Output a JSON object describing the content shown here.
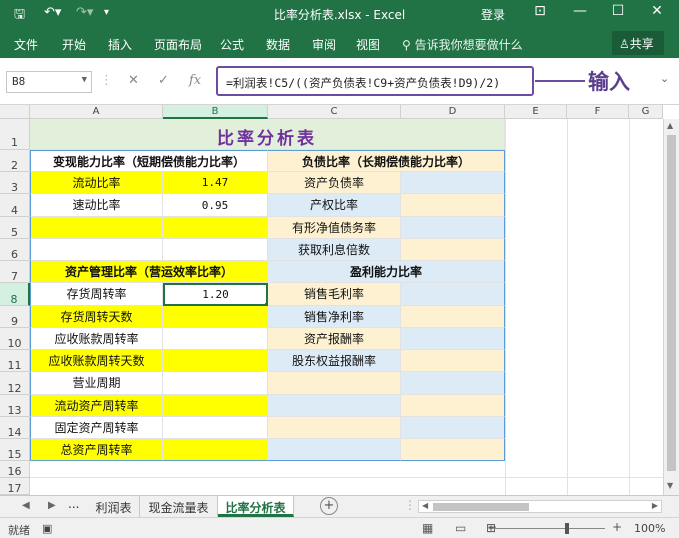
{
  "window": {
    "title": "比率分析表.xlsx - Excel",
    "login": "登录",
    "controls": [
      "⊡",
      "—",
      "☐",
      "✕"
    ]
  },
  "ribbon": {
    "tabs": [
      "文件",
      "开始",
      "插入",
      "页面布局",
      "公式",
      "数据",
      "审阅",
      "视图"
    ],
    "tell_me": "告诉我你想要做什么",
    "share": "共享"
  },
  "formula_bar": {
    "name_box": "B8",
    "formula": "=利润表!C5/((资产负债表!C9+资产负债表!D9)/2)",
    "annotation": "输入"
  },
  "columns": [
    "A",
    "B",
    "C",
    "D",
    "E",
    "F",
    "G"
  ],
  "rows": [
    "1",
    "2",
    "3",
    "4",
    "5",
    "6",
    "7",
    "8",
    "9",
    "10",
    "11",
    "12",
    "13",
    "14",
    "15",
    "16",
    "17"
  ],
  "sheet": {
    "title": "比率分析表",
    "left_header_1": "变现能力比率（短期偿债能力比率）",
    "left_header_2": "资产管理比率（营运效率比率）",
    "right_header_1": "负债比率（长期偿债能力比率）",
    "right_header_2": "盈利能力比率",
    "liquidity": [
      {
        "label": "流动比率",
        "value": "1.47"
      },
      {
        "label": "速动比率",
        "value": "0.95"
      }
    ],
    "asset_mgmt": [
      {
        "label": "存货周转率",
        "value": "1.20"
      },
      {
        "label": "存货周转天数",
        "value": ""
      },
      {
        "label": "应收账款周转率",
        "value": ""
      },
      {
        "label": "应收账款周转天数",
        "value": ""
      },
      {
        "label": "营业周期",
        "value": ""
      },
      {
        "label": "流动资产周转率",
        "value": ""
      },
      {
        "label": "固定资产周转率",
        "value": ""
      },
      {
        "label": "总资产周转率",
        "value": ""
      }
    ],
    "debt": [
      "资产负债率",
      "产权比率",
      "有形净值债务率",
      "获取利息倍数"
    ],
    "profit": [
      "销售毛利率",
      "销售净利率",
      "资产报酬率",
      "股东权益报酬率"
    ]
  },
  "sheet_tabs": {
    "ellipsis": "...",
    "tabs": [
      "利润表",
      "现金流量表",
      "比率分析表"
    ],
    "active": "比率分析表",
    "add": "+"
  },
  "status": {
    "text": "就绪",
    "zoom_minus": "−",
    "zoom_plus": "+",
    "zoom": "100%",
    "zoom_level": 1.0
  },
  "colors": {
    "excel_green": "#217346",
    "title_fill": "#e2efda",
    "title_text": "#7030a0",
    "yellow": "#ffff00",
    "tan": "#fdf1d1",
    "blue": "#ddebf7",
    "annotation": "#6d4ba0"
  }
}
